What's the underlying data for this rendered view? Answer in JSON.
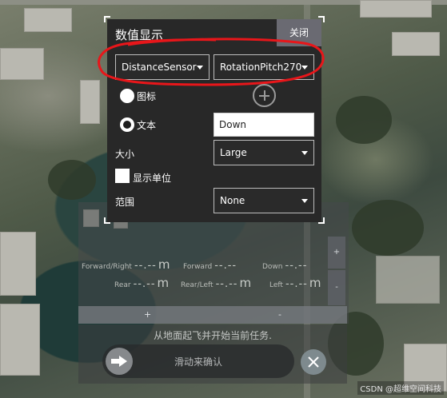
{
  "dialog": {
    "title": "数值显示",
    "close_label": "关闭",
    "group_select": "DistanceSensor",
    "value_select": "RotationPitch270",
    "icon_label": "图标",
    "text_label": "文本",
    "text_value": "Down",
    "size_label": "大小",
    "size_value": "Large",
    "show_units_label": "显示单位",
    "range_label": "范围",
    "range_value": "None"
  },
  "values_panel": {
    "rows": [
      [
        {
          "label": "Forward/Right",
          "value": "--.--",
          "unit": "m"
        },
        {
          "label": "Forward",
          "value": "--.--",
          "unit": ""
        },
        {
          "label": "Down",
          "value": "--.--",
          "unit": ""
        }
      ],
      [
        {
          "label": "Rear",
          "value": "--.--",
          "unit": "m"
        },
        {
          "label": "Rear/Left",
          "value": "--.--",
          "unit": "m"
        },
        {
          "label": "Left",
          "value": "--.--",
          "unit": "m"
        }
      ]
    ],
    "add_label": "+",
    "remove_label": "-",
    "side_add_label": "+",
    "side_remove_label": "-"
  },
  "mission": {
    "message": "从地面起飞并开始当前任务.",
    "slider_text": "滑动来确认"
  },
  "watermark": "CSDN @超维空间科技",
  "colors": {
    "annotation_red": "#e8161a",
    "dialog_bg": "#282828",
    "close_button_bg": "#6a6a72"
  }
}
